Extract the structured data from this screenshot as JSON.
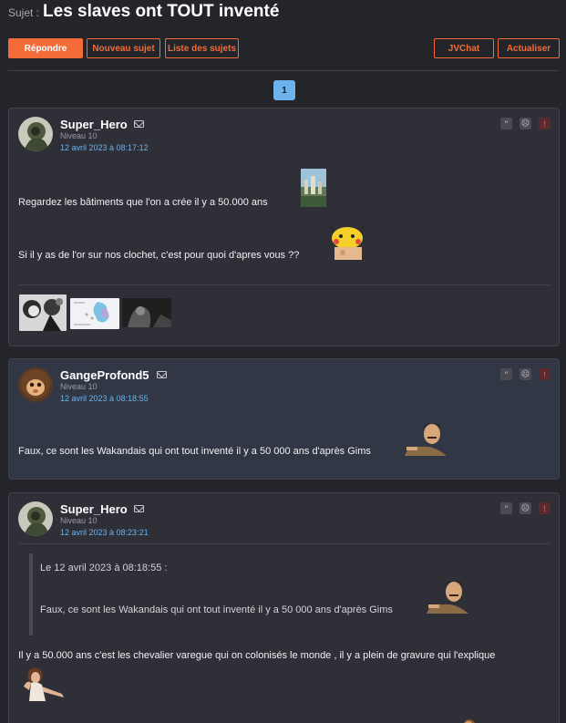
{
  "topic": {
    "prefix": "Sujet :",
    "title": "Les slaves ont TOUT inventé"
  },
  "toolbar": {
    "reply": "Répondre",
    "new_topic": "Nouveau sujet",
    "topic_list": "Liste des sujets",
    "jvchat": "JVChat",
    "refresh": "Actualiser"
  },
  "pagination": {
    "current": "1"
  },
  "posts": [
    {
      "author": "Super_Hero",
      "level": "Niveau 10",
      "date": "12 avril 2023 à 08:17:12",
      "lines": [
        "Regardez les bâtiments que l'on a crée il y a 50.000 ans",
        "Si il y as de l'or sur nos clochet, c'est pour quoi d'apres vous ??"
      ]
    },
    {
      "author": "GangeProfond5",
      "level": "Niveau 10",
      "date": "12 avril 2023 à 08:18:55",
      "lines": [
        "Faux, ce sont les Wakandais qui ont tout inventé il y a 50 000 ans d'après Gims"
      ]
    },
    {
      "author": "Super_Hero",
      "level": "Niveau 10",
      "date": "12 avril 2023 à 08:23:21",
      "quote_header": "Le 12 avril 2023 à 08:18:55 :",
      "quote_text": "Faux, ce sont les Wakandais qui ont tout inventé il y a 50 000 ans d'après Gims",
      "lines": [
        "Il y a 50.000 ans c'est les chevalier varegue qui on colonisés le monde , il y a plein de gravure qui l'explique"
      ]
    }
  ],
  "post_actions": {
    "quote_icon": "\"",
    "mp_icon": "☹",
    "report_icon": "!"
  },
  "colors": {
    "accent": "#f36b36",
    "link": "#6db3ec",
    "background": "#24252b",
    "alert": "#e2464f"
  }
}
